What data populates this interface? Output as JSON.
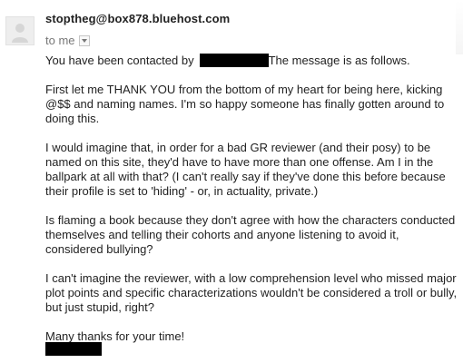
{
  "sender": {
    "email": "stoptheg@box878.bluehost.com"
  },
  "recipient": {
    "label": "to me"
  },
  "body": {
    "p1_before": "You have been contacted by",
    "p1_after": "The message is as follows.",
    "p2": "First let me THANK YOU from the bottom of my heart for being here, kicking @$$ and naming names. I'm so happy someone has finally gotten around to doing this.",
    "p3": "I would imagine that, in order for a bad GR reviewer (and their posy) to be named on this site, they'd have to have more than one offense. Am I in the ballpark at all with that? (I can't really say if they've done this before because their profile is set to 'hiding' - or, in actuality, private.)",
    "p4": "Is flaming a book because they don't agree with how the characters conducted themselves and telling their cohorts and anyone listening to avoid it, considered bullying?",
    "p5": "I can't imagine the reviewer, with a low comprehension level who missed major plot points and specific characterizations wouldn't be considered a troll or bully, but just stupid, right?",
    "p6": "Many thanks for your time!"
  },
  "colors": {
    "redaction": "#000000",
    "sender_text": "#222222",
    "meta_text": "#777777"
  },
  "icons": {
    "avatar": "default-avatar-icon",
    "details_toggle": "chevron-down-icon"
  }
}
